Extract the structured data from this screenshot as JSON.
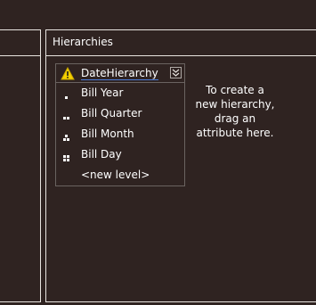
{
  "panes": {
    "hierarchies": {
      "title": "Hierarchies",
      "hierarchy": {
        "name": "DateHierarchy",
        "status_icon": "warning-icon",
        "collapse_icon": "double-chevron-down-icon",
        "levels": [
          {
            "label": "Bill Year",
            "icon": "level-1-dots-icon"
          },
          {
            "label": "Bill Quarter",
            "icon": "level-2-dots-icon"
          },
          {
            "label": "Bill Month",
            "icon": "level-3-dots-icon"
          },
          {
            "label": "Bill Day",
            "icon": "level-4-dots-icon"
          }
        ],
        "new_level_label": "<new level>"
      },
      "instructions_lines": [
        "To create a",
        "new hierarchy,",
        "drag an",
        "attribute here."
      ]
    }
  },
  "colors": {
    "background": "#2f2321",
    "border": "#e8e4e0",
    "box_border": "#6a6360",
    "warning_fill": "#f5d000",
    "link_underline": "#4a7ad8"
  }
}
